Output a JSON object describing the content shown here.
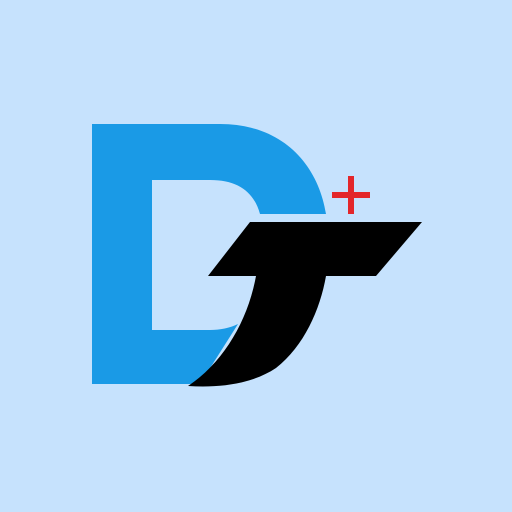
{
  "logo": {
    "colors": {
      "background": "#c6e2fd",
      "d_blue": "#1a9ae6",
      "t_black": "#000000",
      "plus_red": "#e3262a"
    },
    "icons": [
      "d-letter-icon",
      "t-letter-icon",
      "plus-icon"
    ]
  }
}
